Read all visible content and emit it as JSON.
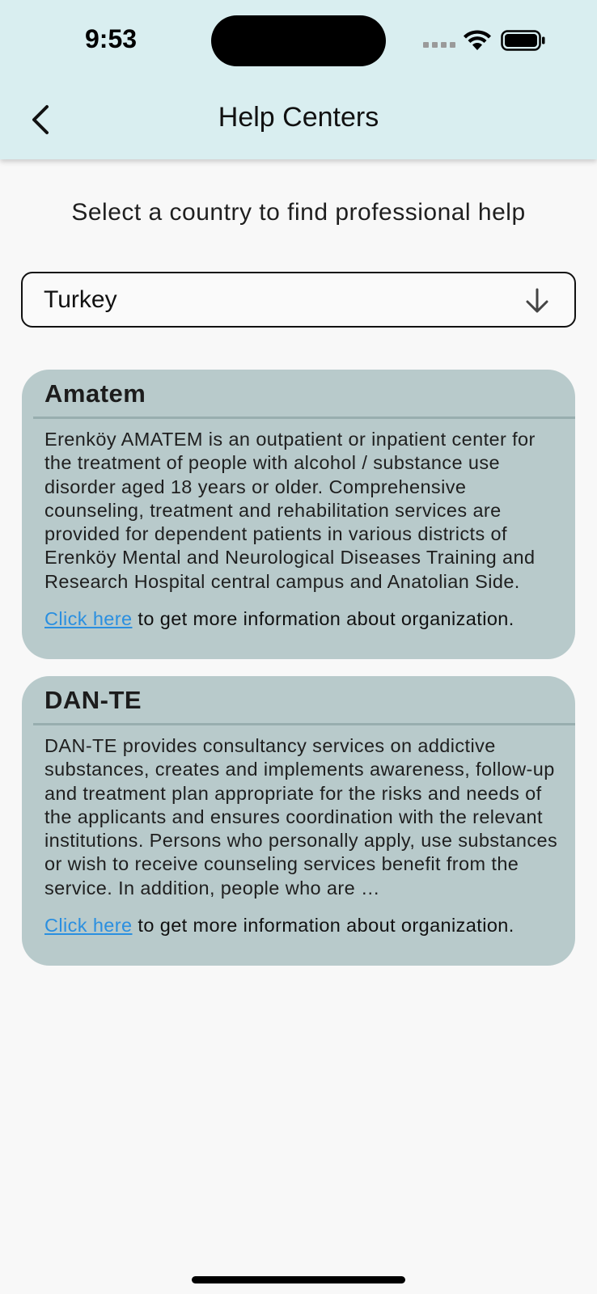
{
  "status_bar": {
    "time": "9:53"
  },
  "header": {
    "title": "Help Centers",
    "back_icon": "chevron-left-icon"
  },
  "subtitle": "Select a country to find professional help",
  "country_select": {
    "value": "Turkey",
    "icon": "arrow-down-icon"
  },
  "centers": [
    {
      "name": "Amatem",
      "description": "Erenköy AMATEM is an outpatient or inpatient center for the treatment of people with alcohol / substance use disorder aged 18 years or older. Comprehensive counseling, treatment and rehabilitation services are provided for dependent patients in various districts of Erenköy Mental and Neurological Diseases Training and Research Hospital central campus and Anatolian Side.",
      "link_label": "Click here",
      "link_suffix": " to get more information about organization."
    },
    {
      "name": "DAN-TE",
      "description": "DAN-TE provides consultancy services on addictive substances, creates and implements awareness, follow-up and treatment plan appropriate for the risks and needs of the applicants and ensures coordination with the relevant institutions.  Persons who personally apply, use substances or wish to receive counseling services benefit from the service. In addition, people who are …",
      "link_label": "Click here",
      "link_suffix": " to get more information about organization."
    }
  ],
  "colors": {
    "app_bar": "#d9eef0",
    "card": "#b8cacb",
    "link": "#2a8fe0",
    "background": "#f8f8f8"
  }
}
